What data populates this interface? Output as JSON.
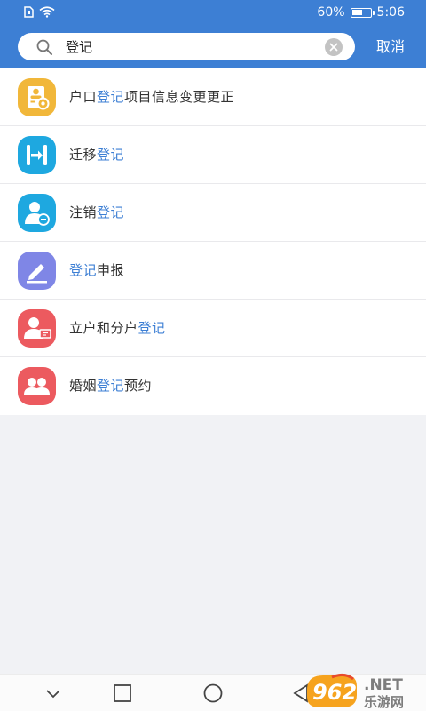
{
  "status_bar": {
    "battery_percent": "60%",
    "battery_level": 0.6,
    "time": "5:06",
    "icons": [
      "sim-icon",
      "wifi-icon",
      "battery-icon"
    ]
  },
  "search": {
    "value": "登记",
    "placeholder": "",
    "cancel_label": "取消"
  },
  "colors": {
    "header_bg": "#3d7fd4",
    "highlight": "#3d7fd4",
    "page_bg": "#f1f2f5"
  },
  "results": [
    {
      "before": "户口",
      "match": "登记",
      "after": "项目信息变更更正",
      "icon": "household-register-icon",
      "icon_color": "#f1b73a"
    },
    {
      "before": "迁移",
      "match": "登记",
      "after": "",
      "icon": "migration-icon",
      "icon_color": "#1ea8e0"
    },
    {
      "before": "注销",
      "match": "登记",
      "after": "",
      "icon": "cancellation-icon",
      "icon_color": "#1ea8e0"
    },
    {
      "before": "",
      "match": "登记",
      "after": "申报",
      "icon": "edit-pen-icon",
      "icon_color": "#7f86e6"
    },
    {
      "before": "立户和分户",
      "match": "登记",
      "after": "",
      "icon": "household-split-icon",
      "icon_color": "#ec5a5f"
    },
    {
      "before": "婚姻",
      "match": "登记",
      "after": "预约",
      "icon": "marriage-icon",
      "icon_color": "#ec5a5f"
    }
  ],
  "navbar": {
    "icons": [
      "back-chevron-icon",
      "recent-apps-icon",
      "home-icon",
      "back-icon"
    ]
  },
  "watermark": {
    "number": "962",
    "suffix": ".NET",
    "caption": "乐游网"
  }
}
